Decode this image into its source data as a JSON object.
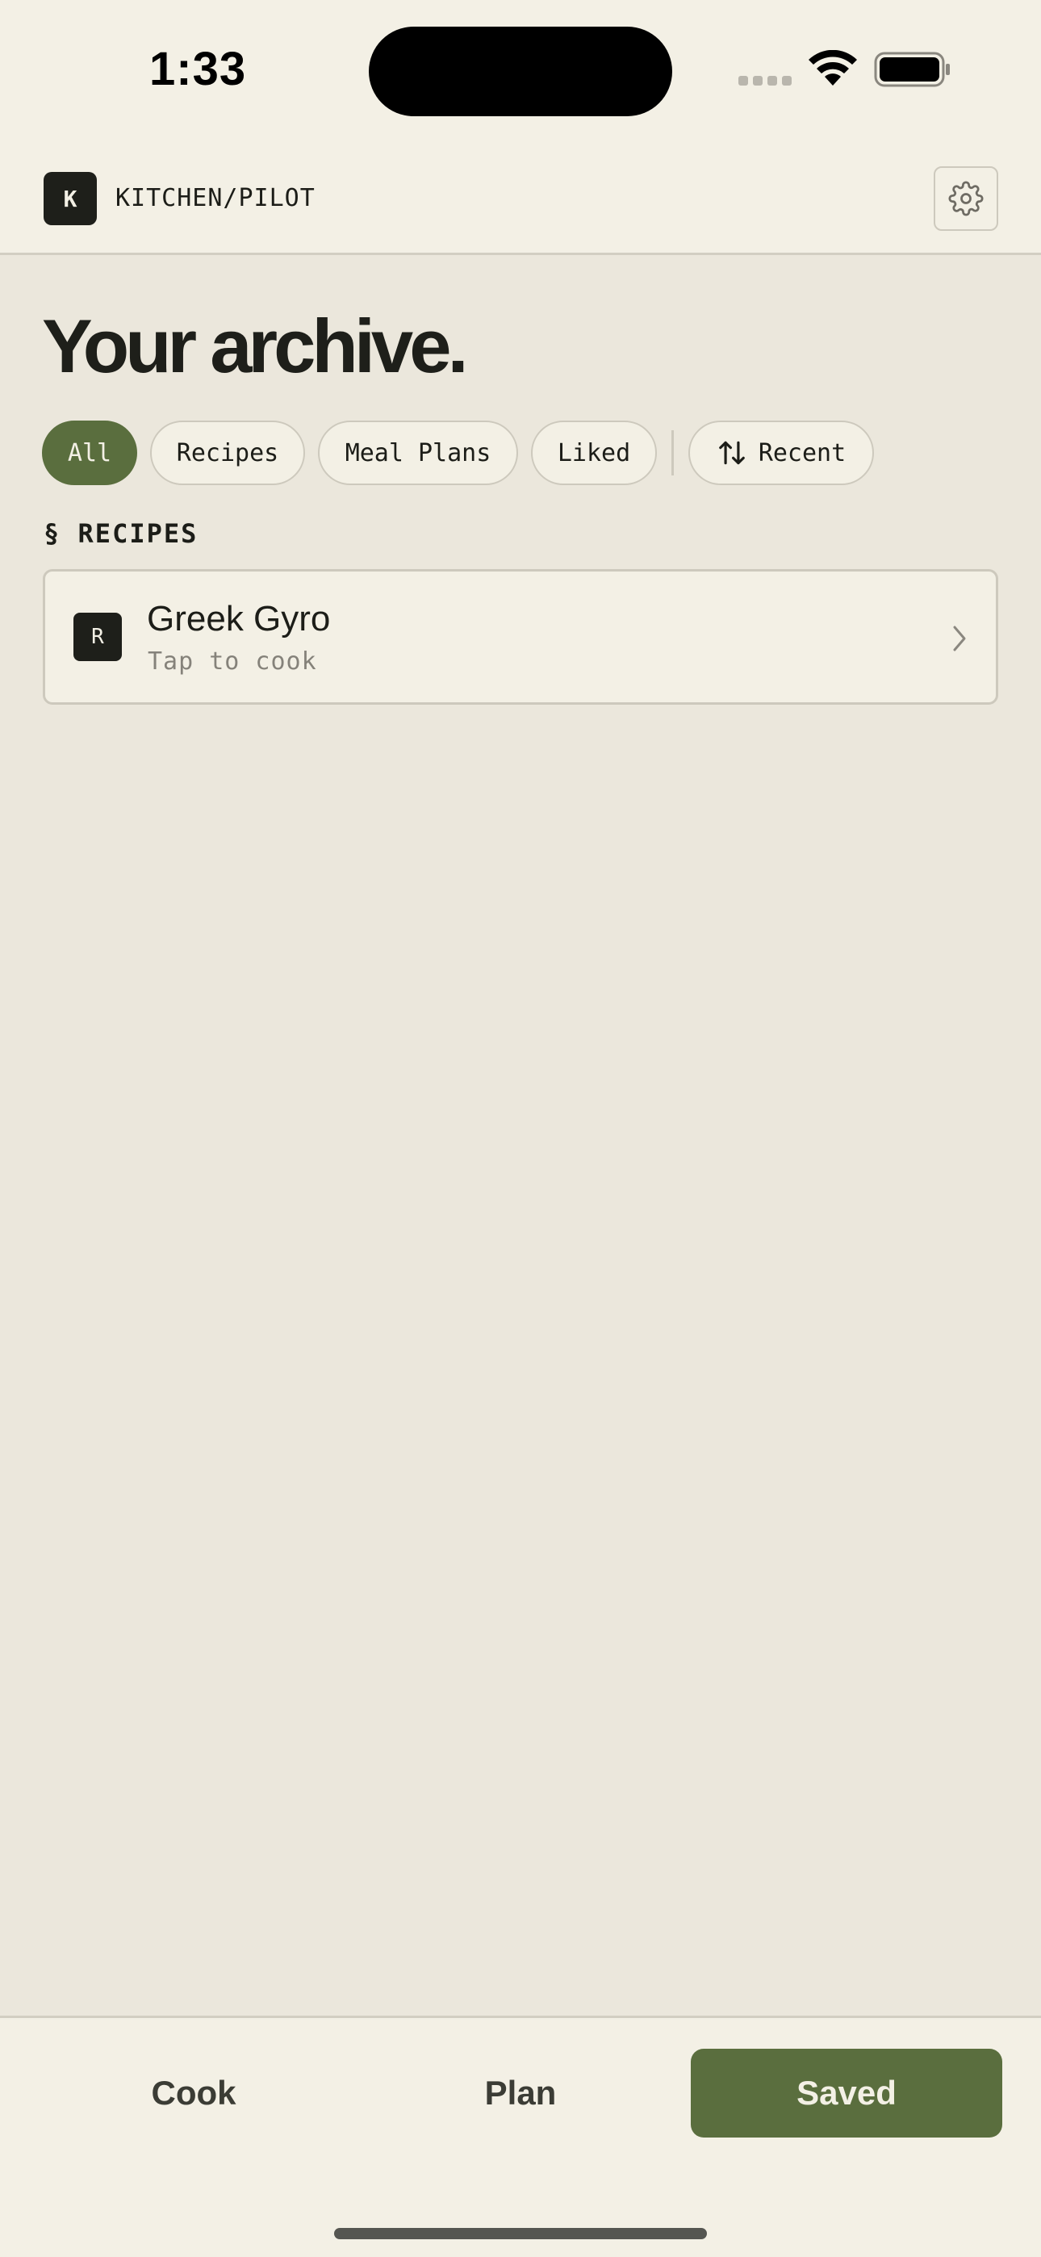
{
  "status_bar": {
    "time": "1:33"
  },
  "header": {
    "brand_initial": "K",
    "brand_name": "KITCHEN/PILOT"
  },
  "main": {
    "title": "Your archive.",
    "filters": [
      {
        "label": "All",
        "active": true
      },
      {
        "label": "Recipes",
        "active": false
      },
      {
        "label": "Meal Plans",
        "active": false
      },
      {
        "label": "Liked",
        "active": false
      }
    ],
    "sort_label": "Recent",
    "section_label": "§ RECIPES",
    "items": [
      {
        "badge": "R",
        "title": "Greek Gyro",
        "subtitle": "Tap to cook"
      }
    ]
  },
  "tabs": [
    {
      "label": "Cook",
      "active": false
    },
    {
      "label": "Plan",
      "active": false
    },
    {
      "label": "Saved",
      "active": true
    }
  ],
  "colors": {
    "accent": "#5A6E3E",
    "background": "#EBE7DC",
    "surface": "#F3F0E5",
    "dark": "#1E1F1A"
  }
}
